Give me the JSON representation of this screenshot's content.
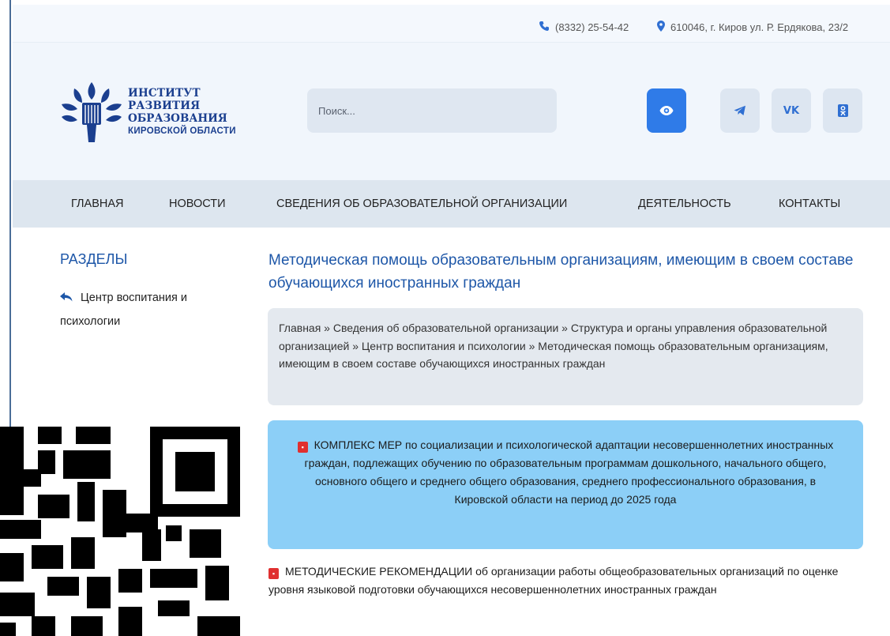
{
  "topbar": {
    "phone": "(8332) 25-54-42",
    "address": "610046, г. Киров ул. Р. Ердякова, 23/2"
  },
  "logo": {
    "line1": "ИНСТИТУТ РАЗВИТИЯ",
    "line2": "ОБРАЗОВАНИЯ",
    "line3": "КИРОВСКОЙ ОБЛАСТИ"
  },
  "search": {
    "placeholder": "Поиск..."
  },
  "header_buttons": {
    "vk_label": "VK"
  },
  "nav": {
    "items": [
      {
        "label": "ГЛАВНАЯ"
      },
      {
        "label": "НОВОСТИ"
      },
      {
        "label": "СВЕДЕНИЯ ОБ ОБРАЗОВАТЕЛЬНОЙ ОРГАНИЗАЦИИ"
      },
      {
        "label": "ДЕЯТЕЛЬНОСТЬ"
      },
      {
        "label": "КОНТАКТЫ"
      }
    ]
  },
  "sidebar": {
    "title": "РАЗДЕЛЫ",
    "back_link": "Центр воспитания и психологии"
  },
  "main": {
    "title": "Методическая помощь образовательным организациям, имеющим в своем составе обучающихся иностранных граждан",
    "breadcrumb": "Главная » Сведения об образовательной организации » Структура и органы управления образовательной организацией » Центр воспитания и психологии » Методическая помощь образовательным организациям, имеющим в своем составе обучающихся иностранных граждан",
    "documents": [
      {
        "title": "КОМПЛЕКС МЕР по социализации и психологической адаптации несовершеннолетних иностранных граждан, подлежащих обучению по образовательным программам дошкольного, начального общего, основного общего и среднего общего образования, среднего профессионального образования, в Кировской области на период до 2025 года"
      },
      {
        "title": "МЕТОДИЧЕСКИЕ РЕКОМЕНДАЦИИ об организации работы общеобразовательных организаций по оценке уровня языковой подготовки обучающихся несовершеннолетних иностранных граждан"
      }
    ]
  },
  "colors": {
    "accent": "#1e57a8",
    "button_blue": "#2f7be8",
    "info_box": "#8ccff7",
    "pdf_red": "#e03030"
  },
  "icons": [
    "phone-icon",
    "map-marker-icon",
    "eye-icon",
    "telegram-icon",
    "vk-icon",
    "odnoklassniki-icon",
    "back-arrow-icon",
    "pdf-icon",
    "qr-code"
  ]
}
